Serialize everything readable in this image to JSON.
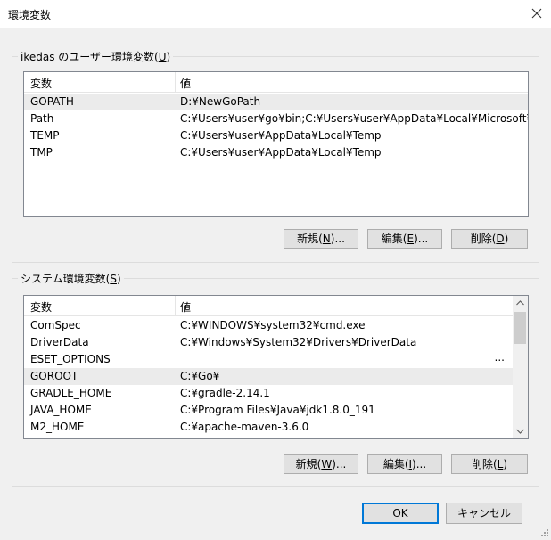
{
  "window": {
    "title": "環境変数"
  },
  "user_section": {
    "legend_prefix": "ikedas のユーザー環境変数(",
    "legend_key": "U",
    "legend_suffix": ")",
    "col_name": "変数",
    "col_value": "値",
    "rows": [
      {
        "name": "GOPATH",
        "value": "D:¥NewGoPath"
      },
      {
        "name": "Path",
        "value": "C:¥Users¥user¥go¥bin;C:¥Users¥user¥AppData¥Local¥Microsoft¥Wi..."
      },
      {
        "name": "TEMP",
        "value": "C:¥Users¥user¥AppData¥Local¥Temp"
      },
      {
        "name": "TMP",
        "value": "C:¥Users¥user¥AppData¥Local¥Temp"
      }
    ],
    "buttons": {
      "new": {
        "prefix": "新規(",
        "key": "N",
        "suffix": ")..."
      },
      "edit": {
        "prefix": "編集(",
        "key": "E",
        "suffix": ")..."
      },
      "delete": {
        "prefix": "削除(",
        "key": "D",
        "suffix": ")"
      }
    }
  },
  "system_section": {
    "legend_prefix": "システム環境変数(",
    "legend_key": "S",
    "legend_suffix": ")",
    "col_name": "変数",
    "col_value": "値",
    "rows": [
      {
        "name": "ComSpec",
        "value": "C:¥WINDOWS¥system32¥cmd.exe"
      },
      {
        "name": "DriverData",
        "value": "C:¥Windows¥System32¥Drivers¥DriverData"
      },
      {
        "name": "ESET_OPTIONS",
        "value": "",
        "more": "..."
      },
      {
        "name": "GOROOT",
        "value": "C:¥Go¥"
      },
      {
        "name": "GRADLE_HOME",
        "value": "C:¥gradle-2.14.1"
      },
      {
        "name": "JAVA_HOME",
        "value": "C:¥Program Files¥Java¥jdk1.8.0_191"
      },
      {
        "name": "M2_HOME",
        "value": "C:¥apache-maven-3.6.0"
      }
    ],
    "buttons": {
      "new": {
        "prefix": "新規(",
        "key": "W",
        "suffix": ")..."
      },
      "edit": {
        "prefix": "編集(",
        "key": "I",
        "suffix": ")..."
      },
      "delete": {
        "prefix": "削除(",
        "key": "L",
        "suffix": ")"
      }
    }
  },
  "footer": {
    "ok": "OK",
    "cancel": "キャンセル"
  }
}
